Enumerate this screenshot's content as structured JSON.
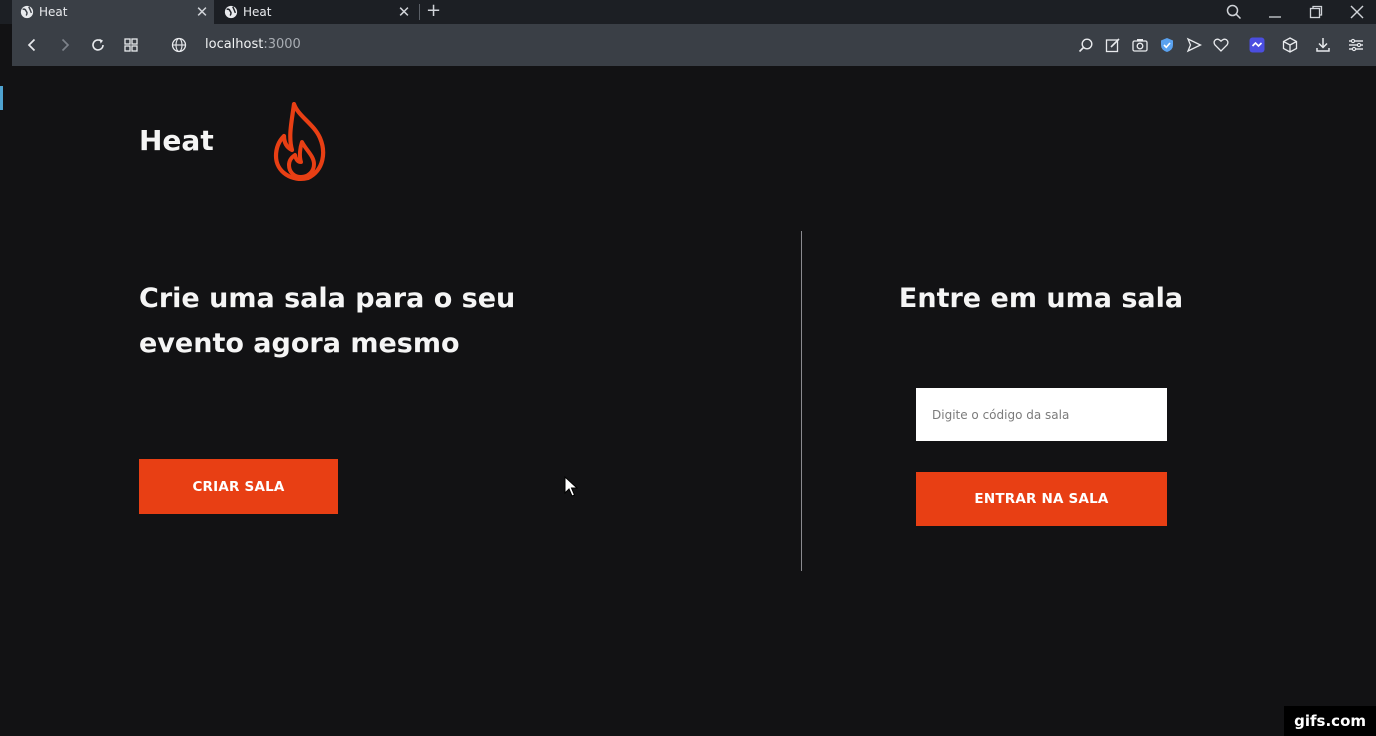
{
  "browser": {
    "tabs": [
      {
        "title": "Heat",
        "close": "✕"
      },
      {
        "title": "Heat",
        "close": "✕"
      }
    ],
    "new_tab": "+",
    "url_host": "localhost",
    "url_port": ":3000",
    "icons": [
      "back-icon",
      "forward-icon",
      "reload-icon",
      "speed-dial-icon",
      "site-info-icon",
      "search-icon",
      "edit-icon",
      "camera-icon",
      "shield-icon",
      "send-icon",
      "heart-icon",
      "extension-icon",
      "cube-icon",
      "download-icon",
      "menu-icon"
    ]
  },
  "page": {
    "logo_text": "Heat",
    "headline": "Crie uma sala para o seu evento agora mesmo",
    "create_button": "CRIAR SALA",
    "join_title": "Entre em uma sala",
    "code_placeholder": "Digite o código da sala",
    "code_value": "",
    "join_button": "ENTRAR NA SALA"
  },
  "watermark": "gifs.com",
  "colors": {
    "background": "#121214",
    "accent": "#e83f14",
    "text": "#f5f5f5"
  }
}
